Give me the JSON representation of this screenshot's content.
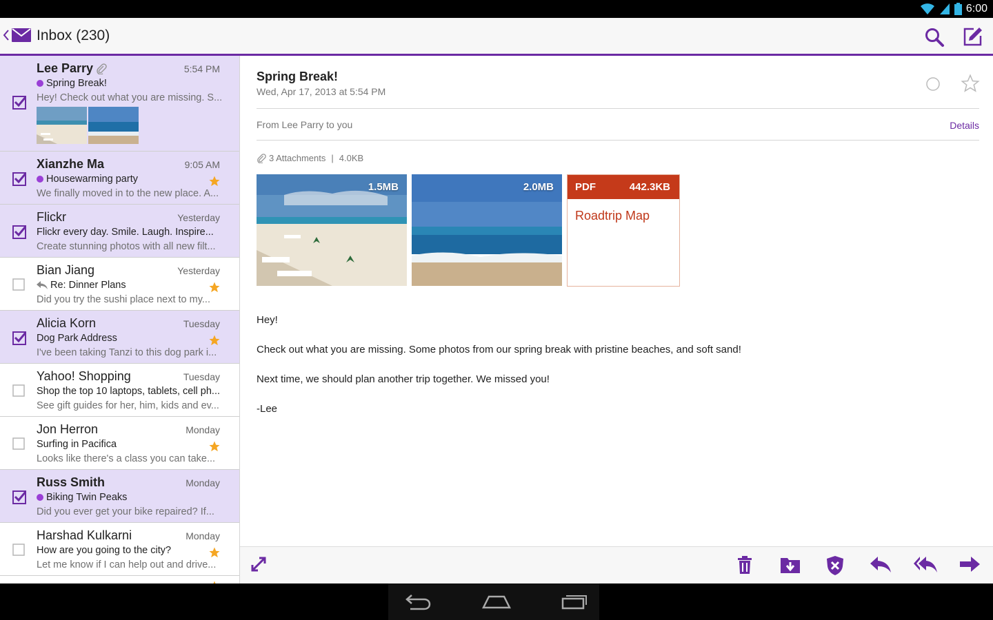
{
  "status": {
    "time": "6:00"
  },
  "header": {
    "title": "Inbox (230)"
  },
  "list": [
    {
      "sender": "Lee Parry",
      "time": "5:54 PM",
      "subject": "Spring Break!",
      "preview": "Hey! Check out what you are missing. S...",
      "selected": true,
      "unread": true,
      "dot": true,
      "attachment": true,
      "star": false
    },
    {
      "sender": "Xianzhe Ma",
      "time": "9:05 AM",
      "subject": "Housewarming party",
      "preview": "We finally moved in to the new place. A...",
      "selected": true,
      "unread": true,
      "dot": true,
      "star": true
    },
    {
      "sender": "Flickr",
      "time": "Yesterday",
      "subject": "Flickr every day. Smile. Laugh. Inspire...",
      "preview": "Create stunning photos with all new filt...",
      "selected": true,
      "unread": false,
      "dot": false,
      "star": false
    },
    {
      "sender": "Bian Jiang",
      "time": "Yesterday",
      "subject": "Re: Dinner Plans",
      "preview": "Did you try the sushi place next to my...",
      "selected": false,
      "unread": false,
      "reply": true,
      "star": true
    },
    {
      "sender": "Alicia Korn",
      "time": "Tuesday",
      "subject": "Dog Park Address",
      "preview": "I've been taking Tanzi to this dog park i...",
      "selected": true,
      "unread": false,
      "star": true
    },
    {
      "sender": "Yahoo! Shopping",
      "time": "Tuesday",
      "subject": "Shop the top 10 laptops, tablets, cell ph...",
      "preview": "See gift guides for her, him, kids and ev...",
      "selected": false,
      "unread": false,
      "star": false
    },
    {
      "sender": "Jon Herron",
      "time": "Monday",
      "subject": "Surfing in Pacifica",
      "preview": "Looks like there's a class you can take...",
      "selected": false,
      "unread": false,
      "star": true
    },
    {
      "sender": "Russ Smith",
      "time": "Monday",
      "subject": "Biking Twin Peaks",
      "preview": "Did you ever get your bike repaired? If...",
      "selected": true,
      "unread": true,
      "dot": true,
      "star": false
    },
    {
      "sender": "Harshad Kulkarni",
      "time": "Monday",
      "subject": "How are you going to the city?",
      "preview": "Let me know if I can help out and drive...",
      "selected": false,
      "unread": false,
      "star": true
    }
  ],
  "message": {
    "subject": "Spring Break!",
    "date": "Wed, Apr 17, 2013 at 5:54 PM",
    "from": "From Lee Parry to you",
    "details": "Details",
    "attachments_summary": "3 Attachments",
    "attachments_size": "4.0KB",
    "attachment1_size": "1.5MB",
    "attachment2_size": "2.0MB",
    "pdf_label": "PDF",
    "pdf_size": "442.3KB",
    "pdf_name": "Roadtrip Map",
    "body": [
      "Hey!",
      "Check out what you are missing. Some photos from our spring break with pristine beaches, and soft sand!",
      "Next time, we should plan another trip together. We missed you!",
      "-Lee"
    ]
  },
  "colors": {
    "accent": "#6b2aa3",
    "selected_bg": "#e4dcf7",
    "unread_dot": "#9a3fd6",
    "star": "#f5a623",
    "pdf": "#c53a1a"
  }
}
